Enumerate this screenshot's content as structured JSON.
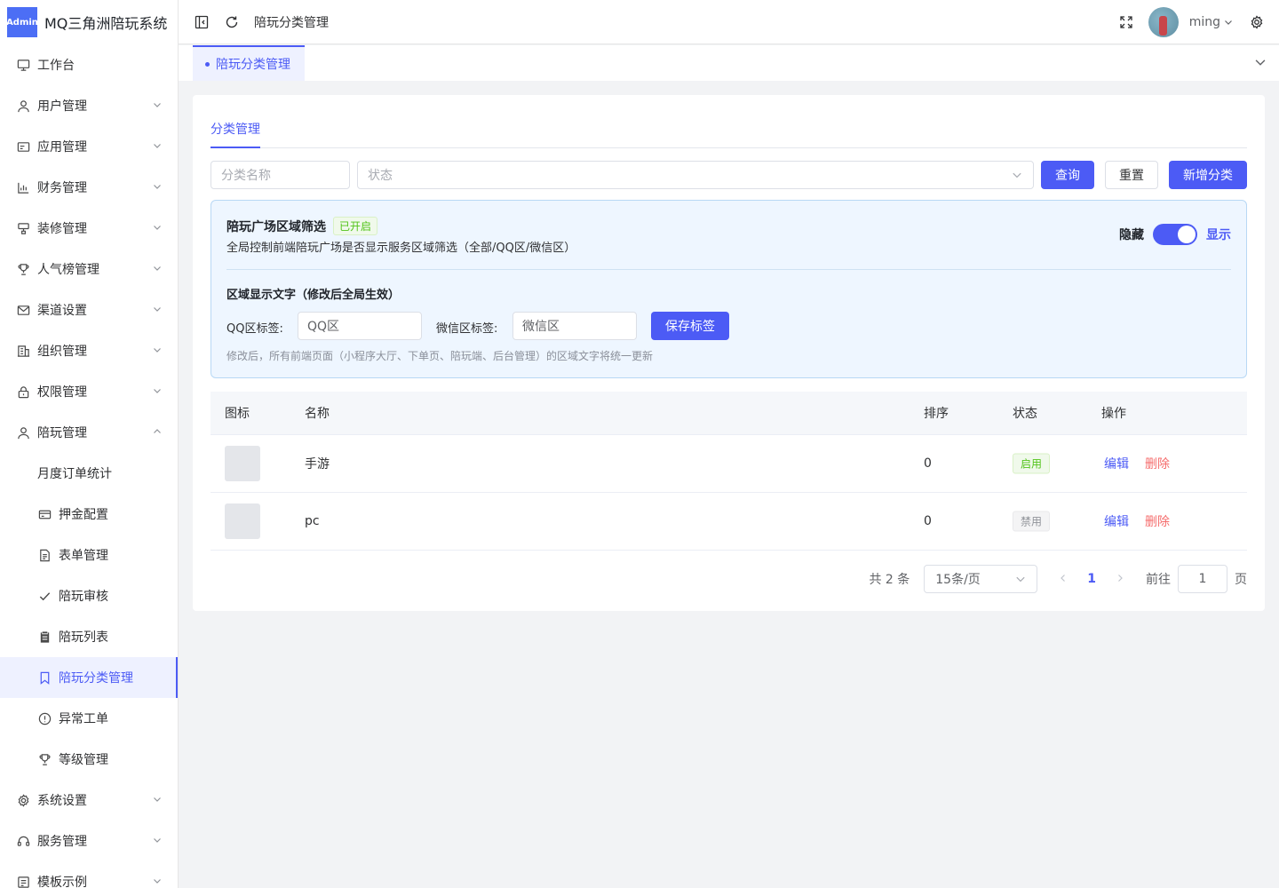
{
  "app": {
    "logo_text": "Admin",
    "title": "MQ三角洲陪玩系统"
  },
  "sidebar": {
    "items": [
      {
        "label": "工作台",
        "icon": "monitor-icon"
      },
      {
        "label": "用户管理",
        "icon": "user-icon"
      },
      {
        "label": "应用管理",
        "icon": "app-icon"
      },
      {
        "label": "财务管理",
        "icon": "chart-icon"
      },
      {
        "label": "装修管理",
        "icon": "decoration-icon"
      },
      {
        "label": "人气榜管理",
        "icon": "trophy-icon"
      },
      {
        "label": "渠道设置",
        "icon": "mail-icon"
      },
      {
        "label": "组织管理",
        "icon": "building-icon"
      },
      {
        "label": "权限管理",
        "icon": "lock-icon"
      },
      {
        "label": "陪玩管理",
        "icon": "user-icon"
      },
      {
        "label": "月度订单统计",
        "icon": ""
      },
      {
        "label": "押金配置",
        "icon": "credit-card-icon"
      },
      {
        "label": "表单管理",
        "icon": "document-icon"
      },
      {
        "label": "陪玩审核",
        "icon": "check-icon"
      },
      {
        "label": "陪玩列表",
        "icon": "clipboard-icon"
      },
      {
        "label": "陪玩分类管理",
        "icon": "bookmark-icon"
      },
      {
        "label": "异常工单",
        "icon": "warning-circle-icon"
      },
      {
        "label": "等级管理",
        "icon": "trophy-icon"
      },
      {
        "label": "系统设置",
        "icon": "gear-icon"
      },
      {
        "label": "服务管理",
        "icon": "headset-icon"
      },
      {
        "label": "模板示例",
        "icon": "template-icon"
      }
    ]
  },
  "header": {
    "breadcrumb": "陪玩分类管理",
    "username": "ming"
  },
  "tabs": {
    "active": "陪玩分类管理"
  },
  "main": {
    "inner_tab": "分类管理",
    "filter": {
      "name_placeholder": "分类名称",
      "status_placeholder": "状态",
      "query": "查询",
      "reset": "重置",
      "add": "新增分类"
    },
    "panel": {
      "title": "陪玩广场区域筛选",
      "badge": "已开启",
      "desc": "全局控制前端陪玩广场是否显示服务区域筛选（全部/QQ区/微信区）",
      "switch_off_label": "隐藏",
      "switch_on_label": "显示",
      "switch_on": true,
      "sub_title": "区域显示文字（修改后全局生效）",
      "qq_label": "QQ区标签:",
      "qq_value": "QQ区",
      "wx_label": "微信区标签:",
      "wx_value": "微信区",
      "save": "保存标签",
      "note": "修改后，所有前端页面（小程序大厅、下单页、陪玩端、后台管理）的区域文字将统一更新"
    },
    "table": {
      "headers": [
        "图标",
        "名称",
        "排序",
        "状态",
        "操作"
      ],
      "rows": [
        {
          "name": "手游",
          "sort": "0",
          "status": "启用",
          "edit": "编辑",
          "delete": "删除"
        },
        {
          "name": "pc",
          "sort": "0",
          "status": "禁用",
          "edit": "编辑",
          "delete": "删除"
        }
      ]
    },
    "pagination": {
      "total": "共 2 条",
      "page_size": "15条/页",
      "current": "1",
      "goto_label": "前往",
      "goto_value": "1",
      "page_suffix": "页"
    }
  },
  "colors": {
    "accent": "#4c5bf5",
    "success": "#52c41a",
    "danger": "#f56c6c"
  }
}
